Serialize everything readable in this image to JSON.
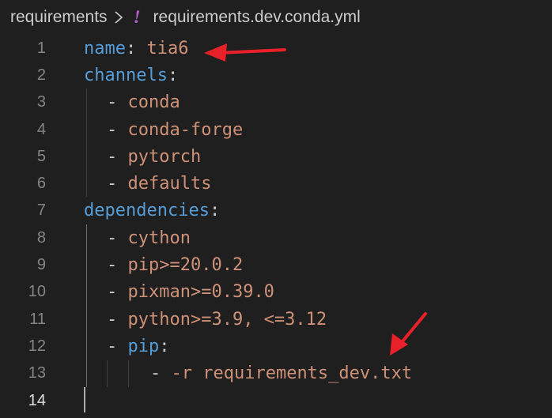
{
  "breadcrumb": {
    "folder": "requirements",
    "file_icon": "!",
    "file_name": "requirements.dev.conda.yml"
  },
  "editor": {
    "lines": [
      {
        "num": "1",
        "key": "name",
        "colon": ":",
        "value": " tia6"
      },
      {
        "num": "2",
        "key": "channels",
        "colon": ":"
      },
      {
        "num": "3",
        "dash": "- ",
        "value": "conda"
      },
      {
        "num": "4",
        "dash": "- ",
        "value": "conda-forge"
      },
      {
        "num": "5",
        "dash": "- ",
        "value": "pytorch"
      },
      {
        "num": "6",
        "dash": "- ",
        "value": "defaults"
      },
      {
        "num": "7",
        "key": "dependencies",
        "colon": ":"
      },
      {
        "num": "8",
        "dash": "- ",
        "value": "cython"
      },
      {
        "num": "9",
        "dash": "- ",
        "value": "pip>=20.0.2"
      },
      {
        "num": "10",
        "dash": "- ",
        "value": "pixman>=0.39.0"
      },
      {
        "num": "11",
        "dash": "- ",
        "value": "python>=3.9, <=3.12"
      },
      {
        "num": "12",
        "dash": "- ",
        "key": "pip",
        "colon": ":"
      },
      {
        "num": "13",
        "dash": "- ",
        "value": "-r requirements_dev.txt"
      },
      {
        "num": "14"
      }
    ]
  },
  "colors": {
    "background": "#1f1f1f",
    "key": "#569cd6",
    "string": "#ce9178",
    "yaml_icon": "#b85fd3",
    "annotation_arrow": "#e8202a"
  }
}
